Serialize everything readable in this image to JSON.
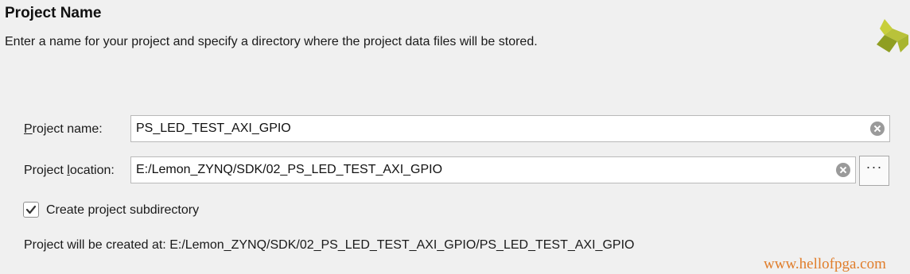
{
  "header": {
    "title": "Project Name",
    "description": "Enter a name for your project and specify a directory where the project data files will be stored."
  },
  "form": {
    "project_name": {
      "label_underlined": "P",
      "label_rest": "roject name:",
      "value": "PS_LED_TEST_AXI_GPIO"
    },
    "project_location": {
      "label_before": "Project ",
      "label_underlined": "l",
      "label_after": "ocation:",
      "value": "E:/Lemon_ZYNQ/SDK/02_PS_LED_TEST_AXI_GPIO",
      "browse_label": "···"
    },
    "create_subdirectory": {
      "label": "Create project subdirectory",
      "checked": true
    },
    "created_at": "Project will be created at: E:/Lemon_ZYNQ/SDK/02_PS_LED_TEST_AXI_GPIO/PS_LED_TEST_AXI_GPIO"
  },
  "watermark": "www.hellofpga.com",
  "icons": {
    "logo": "vivado-logo-icon",
    "clear": "clear-icon",
    "checkmark": "checkmark-icon"
  },
  "colors": {
    "background": "#f0f0f0",
    "logo_light": "#c8cf3a",
    "logo_dark": "#7a8a1c",
    "watermark": "#e07d2b"
  }
}
